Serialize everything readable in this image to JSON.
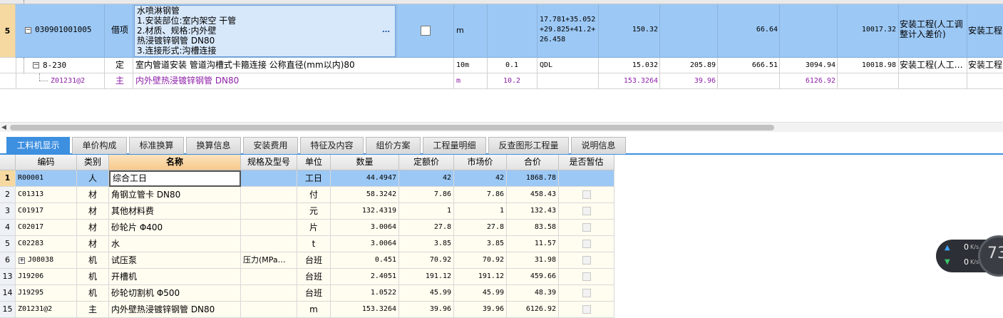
{
  "top_grid": {
    "row5": {
      "num": "5",
      "code": "030901001005",
      "category": "借项",
      "description_lines": [
        "水喷淋钢管",
        "1.安装部位:室内架空 干管",
        "2.材质、规格:内外壁",
        "热浸镀锌钢管  DN80",
        "3.连接形式:沟槽连接"
      ],
      "ellipsis": "…",
      "unit": "m",
      "formula_lines": [
        "17.781+35.052",
        "+29.825+41.2+",
        "26.458"
      ],
      "quantity": "150.32",
      "price": "66.64",
      "total": "10017.32",
      "specialty_lines": [
        "安装工程(人工调",
        "整计入差价)"
      ],
      "specialty2": "安装工程"
    },
    "row_sub": {
      "code": "8-230",
      "category": "定",
      "name": "室内管道安装 管道沟槽式卡箍连接 公称直径(mm以内)80",
      "unit": "10m",
      "content": "0.1",
      "formula": "QDL",
      "quantity": "15.032",
      "price": "205.89",
      "unit_price": "666.51",
      "labor": "3094.94",
      "total": "10018.98",
      "specialty": "安装工程(人工…",
      "specialty2": "安装工程"
    },
    "row_main": {
      "code": "Z01231@2",
      "category": "主",
      "name": "内外壁热浸镀锌钢管 DN80",
      "unit": "m",
      "content": "10.2",
      "quantity": "153.3264",
      "price": "39.96",
      "total": "6126.92"
    }
  },
  "tabs": [
    "工料机显示",
    "单价构成",
    "标准换算",
    "换算信息",
    "安装费用",
    "特征及内容",
    "组价方案",
    "工程量明细",
    "反查图形工程量",
    "说明信息"
  ],
  "bottom_grid": {
    "headers": [
      "编码",
      "类别",
      "名称",
      "规格及型号",
      "单位",
      "数量",
      "定额价",
      "市场价",
      "合价",
      "是否暂估"
    ],
    "rows": [
      {
        "num": "1",
        "code": "R00001",
        "type": "人",
        "name": "综合工日",
        "spec": "",
        "unit": "工日",
        "qty": "44.4947",
        "quota": "42",
        "market": "42",
        "total": "1868.78",
        "expand": false
      },
      {
        "num": "2",
        "code": "C01313",
        "type": "材",
        "name": "角钢立管卡 DN80",
        "spec": "",
        "unit": "付",
        "qty": "58.3242",
        "quota": "7.86",
        "market": "7.86",
        "total": "458.43",
        "expand": false
      },
      {
        "num": "3",
        "code": "C01917",
        "type": "材",
        "name": "其他材料费",
        "spec": "",
        "unit": "元",
        "qty": "132.4319",
        "quota": "1",
        "market": "1",
        "total": "132.43",
        "expand": false
      },
      {
        "num": "4",
        "code": "C02017",
        "type": "材",
        "name": "砂轮片 Φ400",
        "spec": "",
        "unit": "片",
        "qty": "3.0064",
        "quota": "27.8",
        "market": "27.8",
        "total": "83.58",
        "expand": false
      },
      {
        "num": "5",
        "code": "C02283",
        "type": "材",
        "name": "水",
        "spec": "",
        "unit": "t",
        "qty": "3.0064",
        "quota": "3.85",
        "market": "3.85",
        "total": "11.57",
        "expand": false
      },
      {
        "num": "6",
        "code": "J08038",
        "type": "机",
        "name": "试压泵",
        "spec": "压力(MPa…",
        "unit": "台班",
        "qty": "0.451",
        "quota": "70.92",
        "market": "70.92",
        "total": "31.98",
        "expand": true
      },
      {
        "num": "13",
        "code": "J19206",
        "type": "机",
        "name": "开槽机",
        "spec": "",
        "unit": "台班",
        "qty": "2.4051",
        "quota": "191.12",
        "market": "191.12",
        "total": "459.66",
        "expand": false
      },
      {
        "num": "14",
        "code": "J19295",
        "type": "机",
        "name": "砂轮切割机 Φ500",
        "spec": "",
        "unit": "台班",
        "qty": "1.0522",
        "quota": "45.99",
        "market": "45.99",
        "total": "48.39",
        "expand": false
      },
      {
        "num": "15",
        "code": "Z01231@2",
        "type": "主",
        "name": "内外壁热浸镀锌钢管 DN80",
        "spec": "",
        "unit": "m",
        "qty": "153.3264",
        "quota": "39.96",
        "market": "39.96",
        "total": "6126.92",
        "expand": false
      }
    ]
  },
  "net_widget": {
    "up": "0",
    "down": "0",
    "unit": "K/s",
    "percent": "73"
  },
  "colors": {
    "selected_row": "#9cc8f5",
    "active_tab": "#3d8fe0",
    "purple_text": "#8e1fa8",
    "row_bg": "#fffdf0"
  }
}
